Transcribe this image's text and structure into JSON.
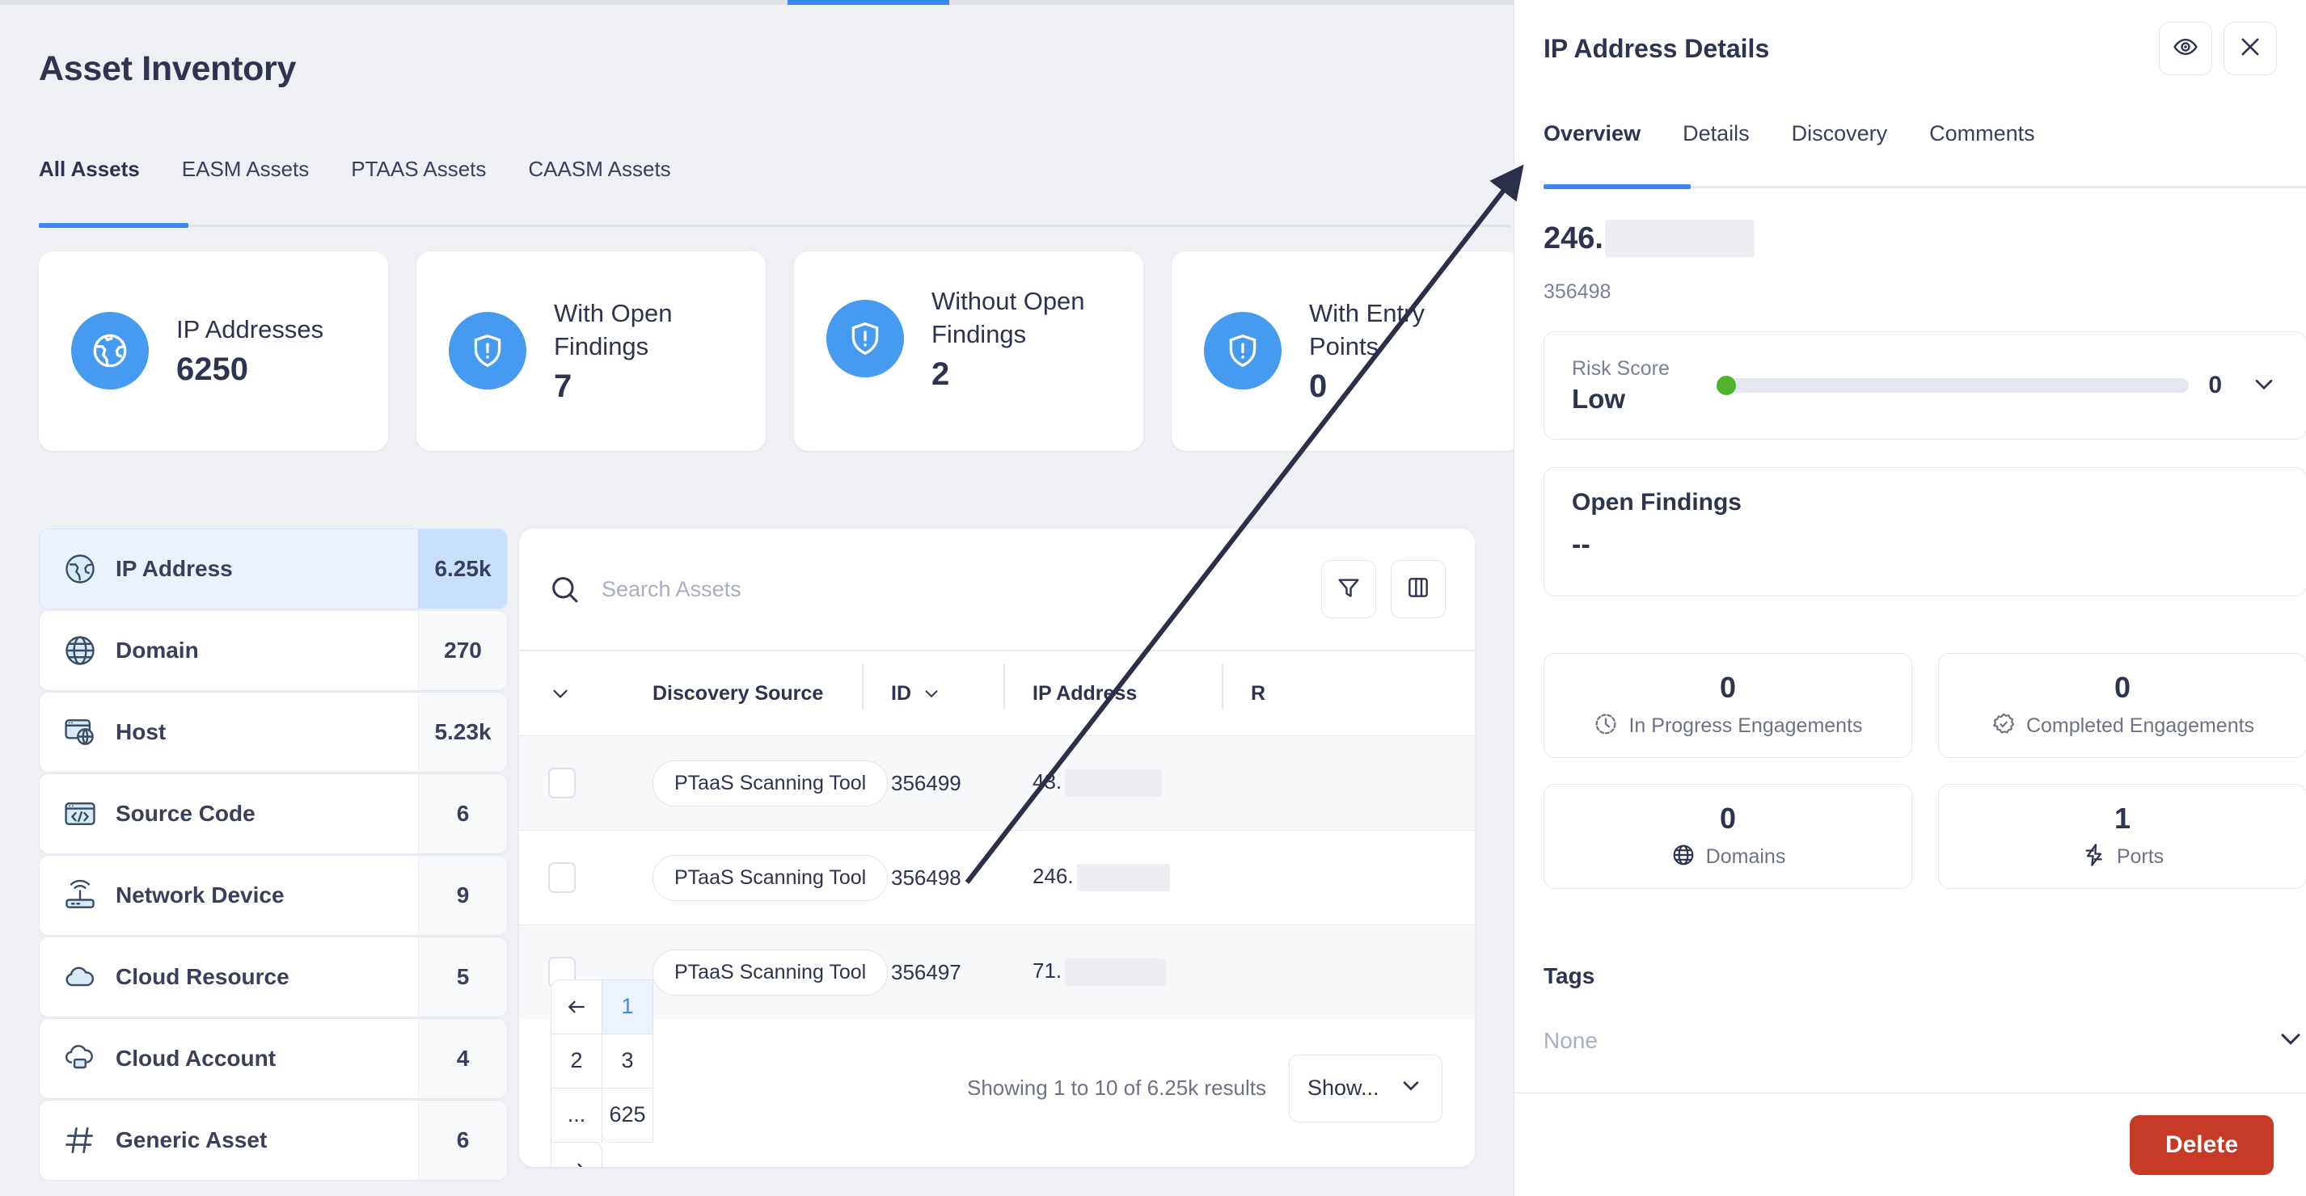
{
  "page": {
    "title": "Asset Inventory"
  },
  "tabs": [
    {
      "label": "All Assets",
      "active": true
    },
    {
      "label": "EASM Assets",
      "active": false
    },
    {
      "label": "PTAAS Assets",
      "active": false
    },
    {
      "label": "CAASM Assets",
      "active": false
    }
  ],
  "stat_cards": [
    {
      "label": "IP Addresses",
      "value": "6250",
      "icon": "globe-pin-icon"
    },
    {
      "label": "With Open Findings",
      "value": "7",
      "icon": "shield-alert-icon"
    },
    {
      "label": "Without Open Findings",
      "value": "2",
      "icon": "shield-alert-icon"
    },
    {
      "label": "With Entry Points",
      "value": "0",
      "icon": "shield-alert-icon"
    }
  ],
  "asset_types": [
    {
      "label": "IP Address",
      "count": "6.25k",
      "icon": "globe-earth-icon",
      "active": true
    },
    {
      "label": "Domain",
      "count": "270",
      "icon": "globe-grid-icon",
      "active": false
    },
    {
      "label": "Host",
      "count": "5.23k",
      "icon": "browser-globe-icon",
      "active": false
    },
    {
      "label": "Source Code",
      "count": "6",
      "icon": "code-window-icon",
      "active": false
    },
    {
      "label": "Network Device",
      "count": "9",
      "icon": "router-icon",
      "active": false
    },
    {
      "label": "Cloud Resource",
      "count": "5",
      "icon": "cloud-icon",
      "active": false
    },
    {
      "label": "Cloud Account",
      "count": "4",
      "icon": "cloud-account-icon",
      "active": false
    },
    {
      "label": "Generic Asset",
      "count": "6",
      "icon": "hash-icon",
      "active": false
    }
  ],
  "table": {
    "search_placeholder": "Search Assets",
    "search_value": "",
    "filter_icon": "filter-icon",
    "columns_icon": "columns-icon",
    "headers": {
      "select": "",
      "discovery_source": "Discovery Source",
      "id": "ID",
      "ip_address": "IP Address",
      "r": "R"
    },
    "rows": [
      {
        "source": "PTaaS Scanning Tool",
        "id": "356499",
        "ip_prefix": "43.",
        "status": "green"
      },
      {
        "source": "PTaaS Scanning Tool",
        "id": "356498",
        "ip_prefix": "246.",
        "status": "green"
      },
      {
        "source": "PTaaS Scanning Tool",
        "id": "356497",
        "ip_prefix": "71.",
        "status": "green"
      }
    ]
  },
  "pagination": {
    "prev_icon": "arrow-left-icon",
    "next_icon": "arrow-right-icon",
    "pages": [
      "1",
      "2",
      "3",
      "..."
    ],
    "current_page": "1",
    "last_page": "625",
    "showing_text": "Showing 1 to 10 of 6.25k results",
    "page_size_label": "Show...",
    "page_size_chevron": "chevron-down-icon"
  },
  "detail_panel": {
    "title": "IP Address Details",
    "eye_icon": "eye-icon",
    "close_icon": "close-icon",
    "tabs": [
      {
        "label": "Overview",
        "active": true
      },
      {
        "label": "Details",
        "active": false
      },
      {
        "label": "Discovery",
        "active": false
      },
      {
        "label": "Comments",
        "active": false
      }
    ],
    "ip_prefix": "246.",
    "asset_id": "356498",
    "risk": {
      "label": "Risk Score",
      "value_text": "Low",
      "score": "0",
      "knob_color": "#4fb32e",
      "chevron": "chevron-down-icon"
    },
    "open_findings": {
      "title": "Open Findings",
      "value": "--"
    },
    "metrics": [
      {
        "value": "0",
        "label": "In Progress Engagements",
        "icon": "clock-progress-icon"
      },
      {
        "value": "0",
        "label": "Completed Engagements",
        "icon": "badge-check-icon"
      },
      {
        "value": "0",
        "label": "Domains",
        "icon": "globe-grid-icon"
      },
      {
        "value": "1",
        "label": "Ports",
        "icon": "bolt-icon"
      }
    ],
    "tags": {
      "title": "Tags",
      "value": "None",
      "chevron": "chevron-down-icon"
    },
    "delete_label": "Delete"
  },
  "colors": {
    "accent": "#3b87ef",
    "stat_icon_bg": "#469bf0",
    "status_green": "#54b848",
    "risk_green": "#4fb32e",
    "delete_red": "#c63a26",
    "page_bg": "#eef0f4",
    "text_primary": "#2e3350"
  }
}
